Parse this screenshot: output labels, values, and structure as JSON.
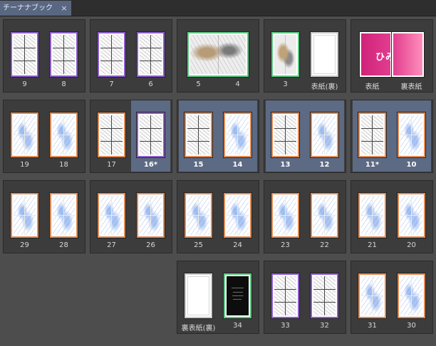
{
  "tab": {
    "title": "チーナナブック",
    "close_glyph": "×"
  },
  "cover_text": "ひみつ",
  "spreads": [
    {
      "pages": [
        {
          "label": "9",
          "style": "ink",
          "border": "purple"
        },
        {
          "label": "8",
          "style": "ink",
          "border": "purple"
        }
      ]
    },
    {
      "pages": [
        {
          "label": "7",
          "style": "ink",
          "border": "purple"
        },
        {
          "label": "6",
          "style": "ink",
          "border": "purple"
        }
      ]
    },
    {
      "wide": true,
      "border": "green",
      "labels": [
        "5",
        "4"
      ]
    },
    {
      "pages": [
        {
          "label": "3",
          "style": "color",
          "border": "green"
        },
        {
          "label": "表紙(裏)",
          "style": "blank",
          "border": "gray"
        }
      ]
    },
    {
      "pages": [
        {
          "label": "表紙",
          "style": "cover",
          "border": "none"
        },
        {
          "label": "裏表紙",
          "style": "cover",
          "border": "none"
        }
      ]
    },
    {
      "pages": [
        {
          "label": "19",
          "style": "rough",
          "border": "orange"
        },
        {
          "label": "18",
          "style": "rough",
          "border": "orange"
        }
      ]
    },
    {
      "pages": [
        {
          "label": "17",
          "style": "ink",
          "border": "orange"
        },
        {
          "label": "16*",
          "style": "ink",
          "border": "purple",
          "selected": true
        }
      ]
    },
    {
      "pages": [
        {
          "label": "15",
          "style": "ink",
          "border": "orange",
          "selected": true
        },
        {
          "label": "14",
          "style": "rough",
          "border": "orange",
          "selected": true
        }
      ]
    },
    {
      "pages": [
        {
          "label": "13",
          "style": "ink",
          "border": "orange",
          "selected": true
        },
        {
          "label": "12",
          "style": "rough",
          "border": "orange",
          "selected": true
        }
      ]
    },
    {
      "pages": [
        {
          "label": "11*",
          "style": "ink",
          "border": "orange",
          "selected": true
        },
        {
          "label": "10",
          "style": "rough",
          "border": "orange",
          "selected": true
        }
      ]
    },
    {
      "pages": [
        {
          "label": "29",
          "style": "rough",
          "border": "orange"
        },
        {
          "label": "28",
          "style": "rough",
          "border": "orange"
        }
      ]
    },
    {
      "pages": [
        {
          "label": "27",
          "style": "rough",
          "border": "orange"
        },
        {
          "label": "26",
          "style": "rough",
          "border": "orange"
        }
      ]
    },
    {
      "pages": [
        {
          "label": "25",
          "style": "rough",
          "border": "orange"
        },
        {
          "label": "24",
          "style": "rough",
          "border": "orange"
        }
      ]
    },
    {
      "pages": [
        {
          "label": "23",
          "style": "rough",
          "border": "orange"
        },
        {
          "label": "22",
          "style": "rough",
          "border": "orange"
        }
      ]
    },
    {
      "pages": [
        {
          "label": "21",
          "style": "rough",
          "border": "orange"
        },
        {
          "label": "20",
          "style": "rough",
          "border": "orange"
        }
      ]
    },
    {
      "pages": [
        {
          "label": "裏表紙(裏)",
          "style": "blank",
          "border": "gray"
        },
        {
          "label": "34",
          "style": "dark",
          "border": "green"
        }
      ]
    },
    {
      "pages": [
        {
          "label": "33",
          "style": "ink",
          "border": "purple"
        },
        {
          "label": "32",
          "style": "ink",
          "border": "purple"
        }
      ]
    },
    {
      "pages": [
        {
          "label": "31",
          "style": "rough",
          "border": "orange"
        },
        {
          "label": "30",
          "style": "rough",
          "border": "orange"
        }
      ]
    }
  ]
}
